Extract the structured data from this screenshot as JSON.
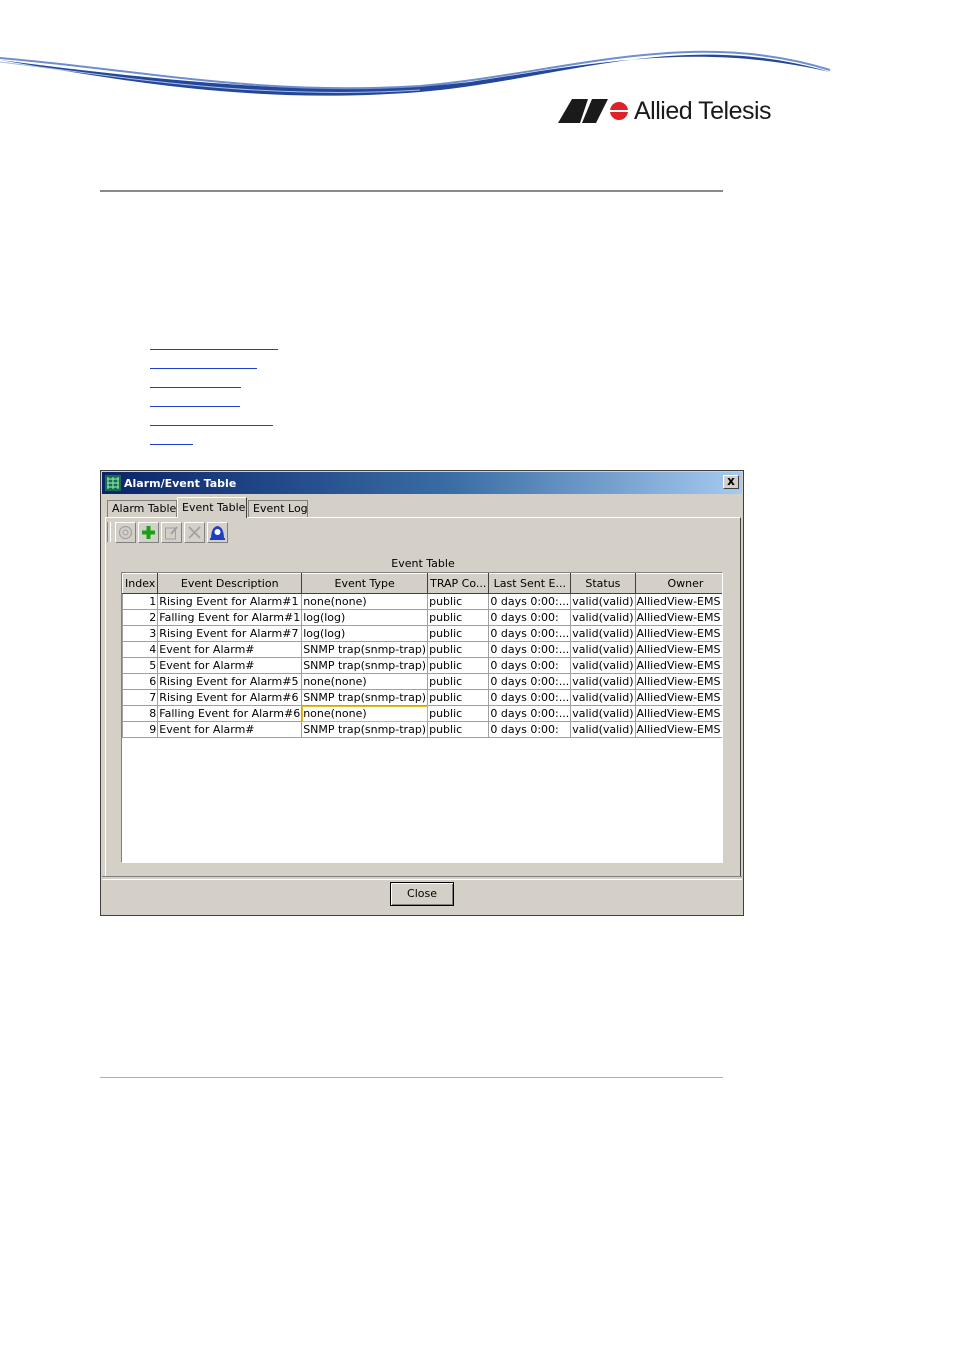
{
  "brand": {
    "name": "Allied Telesis",
    "accent": "#1f3f8f",
    "logo_red": "#e0202a"
  },
  "dialog": {
    "title": "Alarm/Event Table",
    "close_glyph": "x",
    "tabs": [
      {
        "label": "Alarm Table"
      },
      {
        "label": "Event Table"
      },
      {
        "label": "Event Log"
      }
    ],
    "active_tab": "Event Table",
    "toolbar": [
      "refresh-icon",
      "add-icon",
      "edit-icon",
      "delete-icon",
      "alarm-icon"
    ],
    "table_caption": "Event Table",
    "columns": [
      "Index",
      "Event Description",
      "Event Type",
      "TRAP Co...",
      "Last Sent E...",
      "Status",
      "Owner"
    ],
    "rows": [
      [
        "1",
        "Rising Event for Alarm#1",
        "none(none)",
        "public",
        "0 days 0:00:...",
        "valid(valid)",
        "AlliedView-EMS ..."
      ],
      [
        "2",
        "Falling Event for Alarm#1",
        "log(log)",
        "public",
        "0 days 0:00:",
        "valid(valid)",
        "AlliedView-EMS ..."
      ],
      [
        "3",
        "Rising Event for Alarm#7",
        "log(log)",
        "public",
        "0 days 0:00:...",
        "valid(valid)",
        "AlliedView-EMS ..."
      ],
      [
        "4",
        "Event for Alarm#",
        "SNMP trap(snmp-trap)",
        "public",
        "0 days 0:00:...",
        "valid(valid)",
        "AlliedView-EMS ..."
      ],
      [
        "5",
        "Event for Alarm#",
        "SNMP trap(snmp-trap)",
        "public",
        "0 days 0:00:",
        "valid(valid)",
        "AlliedView-EMS ..."
      ],
      [
        "6",
        "Rising Event for Alarm#5",
        "none(none)",
        "public",
        "0 days 0:00:...",
        "valid(valid)",
        "AlliedView-EMS ..."
      ],
      [
        "7",
        "Rising Event for Alarm#6",
        "SNMP trap(snmp-trap)",
        "public",
        "0 days 0:00:...",
        "valid(valid)",
        "AlliedView-EMS ..."
      ],
      [
        "8",
        "Falling Event for Alarm#6",
        "none(none)",
        "public",
        "0 days 0:00:...",
        "valid(valid)",
        "AlliedView-EMS ..."
      ],
      [
        "9",
        "Event for Alarm#",
        "SNMP trap(snmp-trap)",
        "public",
        "0 days 0:00:",
        "valid(valid)",
        "AlliedView-EMS"
      ]
    ],
    "close_button": "Close"
  }
}
